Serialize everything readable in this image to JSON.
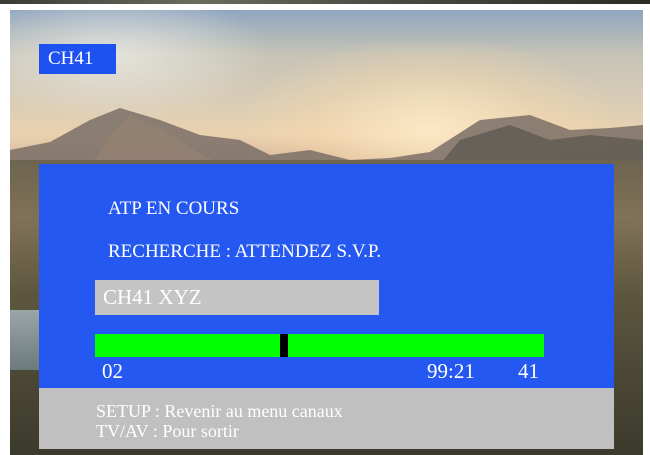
{
  "channel_badge": "CH41",
  "panel": {
    "status_line": "ATP EN COURS",
    "search_line": "RECHERCHE  :  ATTENDEZ S.V.P.",
    "channel_name_box": "CH41  XYZ",
    "progress": {
      "marker_fraction": 0.42,
      "start_label": "02",
      "time_label": "99:21",
      "end_label": "41"
    }
  },
  "footer": {
    "line1": "SETUP : Revenir au menu canaux",
    "line2": "TV/AV : Pour sortir"
  },
  "colors": {
    "panel_blue": "#2458f0",
    "badge_blue": "#1e52f0",
    "progress_green": "#00ff00",
    "footer_grey": "#c0c0c0"
  }
}
